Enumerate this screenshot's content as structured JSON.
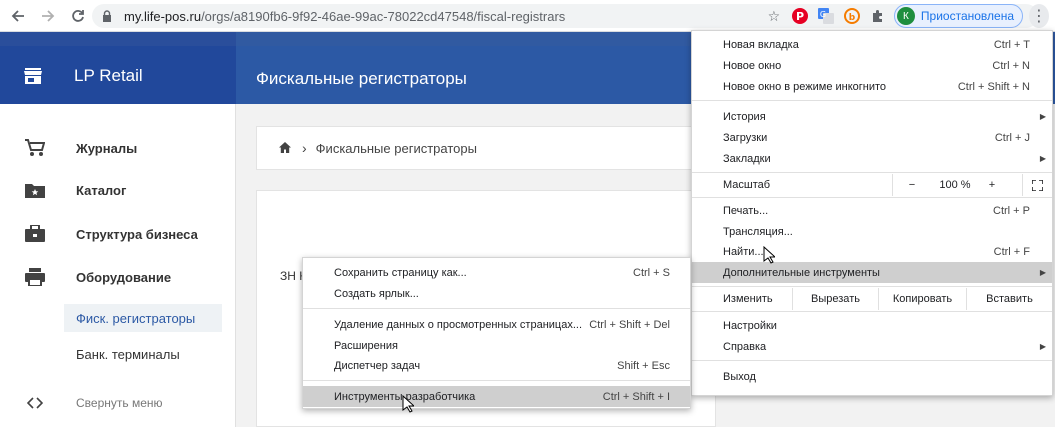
{
  "browser": {
    "url_host": "my.life-pos.ru",
    "url_path": "/orgs/a8190fb6-9f92-46ae-99ac-78022cd47548/fiscal-registrars",
    "profile_initial": "К",
    "profile_status": "Приостановлена",
    "icons": [
      "back-icon",
      "forward-icon",
      "reload-icon",
      "lock-icon",
      "star-icon",
      "pinterest-icon",
      "translate-icon",
      "extension-icon",
      "puzzle-icon",
      "kebab-icon"
    ]
  },
  "app": {
    "brand": "LP Retail",
    "page_title": "Фискальные регистраторы",
    "sidebar": {
      "items": [
        {
          "label": "Журналы",
          "icon": "cart-icon"
        },
        {
          "label": "Каталог",
          "icon": "folder-star-icon"
        },
        {
          "label": "Структура бизнеса",
          "icon": "briefcase-icon"
        },
        {
          "label": "Оборудование",
          "icon": "printer-icon"
        }
      ],
      "sub_items": [
        {
          "label": "Фиск. регистраторы",
          "active": true
        },
        {
          "label": "Банк. терминалы",
          "active": false
        }
      ],
      "collapse_label": "Свернуть меню"
    },
    "breadcrumb": {
      "current": "Фискальные регистраторы"
    },
    "card_label_fragment": "ЗН К"
  },
  "chrome_menu": {
    "items": [
      {
        "label": "Новая вкладка",
        "shortcut": "Ctrl + T"
      },
      {
        "label": "Новое окно",
        "shortcut": "Ctrl + N"
      },
      {
        "label": "Новое окно в режиме инкогнито",
        "shortcut": "Ctrl + Shift + N"
      },
      {
        "label": "История",
        "shortcut": ""
      },
      {
        "label": "Загрузки",
        "shortcut": "Ctrl + J"
      },
      {
        "label": "Закладки",
        "shortcut": ""
      },
      {
        "label": "Печать...",
        "shortcut": "Ctrl + P"
      },
      {
        "label": "Трансляция...",
        "shortcut": ""
      },
      {
        "label": "Найти...",
        "shortcut": "Ctrl + F"
      },
      {
        "label": "Дополнительные инструменты",
        "shortcut": ""
      },
      {
        "label": "Настройки",
        "shortcut": ""
      },
      {
        "label": "Справка",
        "shortcut": ""
      },
      {
        "label": "Выход",
        "shortcut": ""
      }
    ],
    "zoom": {
      "label": "Масштаб",
      "minus": "−",
      "value": "100 %",
      "plus": "+"
    },
    "edit": {
      "label": "Изменить",
      "cut": "Вырезать",
      "copy": "Копировать",
      "paste": "Вставить"
    }
  },
  "submenu": {
    "items": [
      {
        "label": "Сохранить страницу как...",
        "shortcut": "Ctrl + S"
      },
      {
        "label": "Создать ярлык...",
        "shortcut": ""
      },
      {
        "label": "Удаление данных о просмотренных страницах...",
        "shortcut": "Ctrl + Shift + Del"
      },
      {
        "label": "Расширения",
        "shortcut": ""
      },
      {
        "label": "Диспетчер задач",
        "shortcut": "Shift + Esc"
      },
      {
        "label": "Инструменты разработчика",
        "shortcut": "Ctrl + Shift + I"
      }
    ]
  },
  "colors": {
    "header": "#2c59a5",
    "header_dark": "#21489b",
    "highlight": "#cfcfcf",
    "accent": "#1a73e8"
  }
}
